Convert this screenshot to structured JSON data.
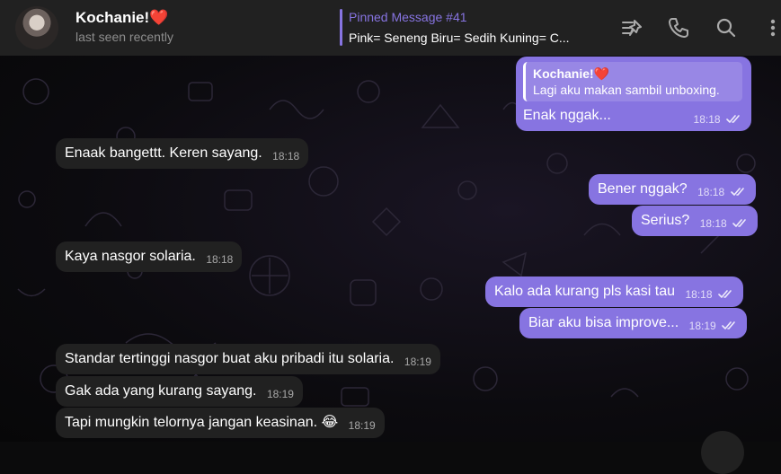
{
  "header": {
    "title": "Kochanie!❤️",
    "status": "last seen recently",
    "pinned": {
      "label": "Pinned Message #41",
      "text": "Pink= Seneng Biru= Sedih Kuning= C..."
    },
    "icons": [
      "pin-list-icon",
      "phone-icon",
      "search-icon",
      "more-vertical-icon"
    ]
  },
  "messages": [
    {
      "dir": "out",
      "reply_name": "Kochanie!❤️",
      "reply_text": "Lagi aku makan sambil unboxing.",
      "text": "Enak nggak...",
      "time": "18:18",
      "read": true
    },
    {
      "dir": "in",
      "text": "Enaak bangettt. Keren sayang.",
      "time": "18:18"
    },
    {
      "dir": "out",
      "text": "Bener nggak?",
      "time": "18:18",
      "read": true
    },
    {
      "dir": "out",
      "text": "Serius?",
      "time": "18:18",
      "read": true
    },
    {
      "dir": "in",
      "text": "Kaya nasgor solaria.",
      "time": "18:18"
    },
    {
      "dir": "out",
      "text": "Kalo ada kurang pls kasi tau",
      "time": "18:18",
      "read": true
    },
    {
      "dir": "out",
      "text": "Biar aku bisa improve...",
      "time": "18:19",
      "read": true
    },
    {
      "dir": "in",
      "text": "Standar tertinggi nasgor buat aku pribadi itu solaria.",
      "time": "18:19"
    },
    {
      "dir": "in",
      "text": "Gak ada yang kurang sayang.",
      "time": "18:19"
    },
    {
      "dir": "in",
      "text": "Tapi mungkin telornya jangan keasinan. 😂",
      "time": "18:19"
    }
  ],
  "colors": {
    "header_bg": "#212121",
    "outgoing_bubble": "#8774e1",
    "incoming_bubble": "#212121",
    "accent": "#8774e1"
  }
}
